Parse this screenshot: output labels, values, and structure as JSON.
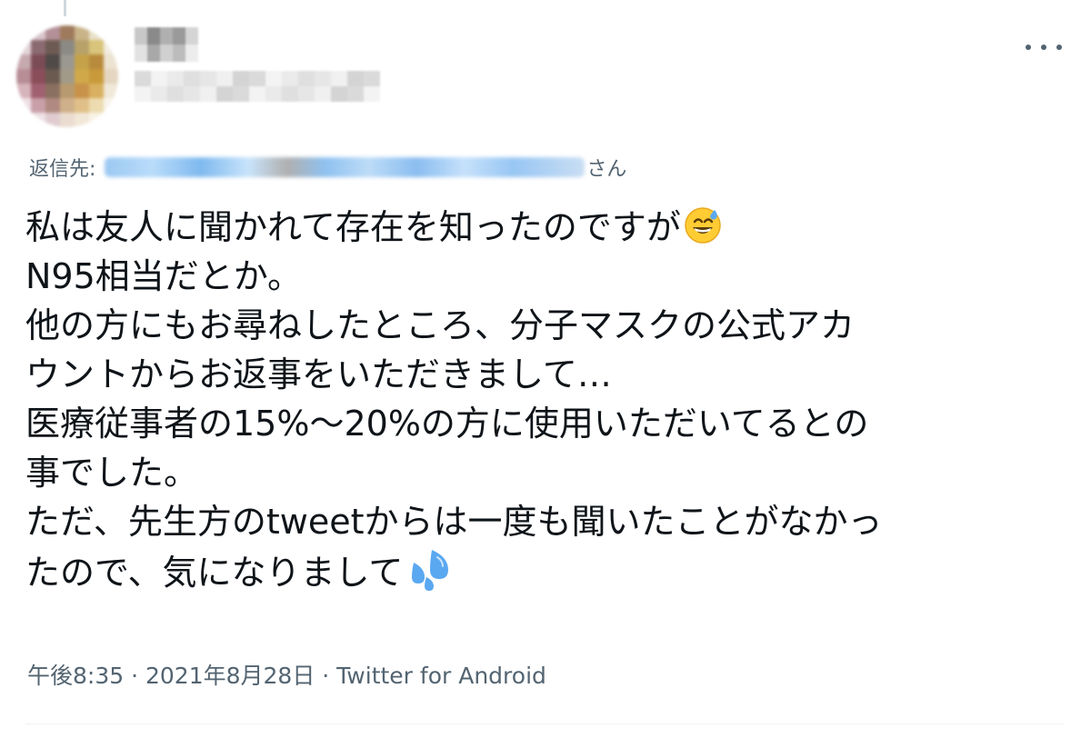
{
  "reply": {
    "prefix": "返信先: ",
    "suffix": "さん"
  },
  "tweet": {
    "lines": [
      "私は友人に聞かれて存在を知ったのですが",
      "N95相当だとか。",
      "他の方にもお尋ねしたところ、分子マスクの公式アカ",
      "ウントからお返事をいただきまして…",
      "医療従事者の15%〜20%の方に使用いただいてるとの",
      "事でした。",
      "ただ、先生方のtweetからは一度も聞いたことがなかっ",
      "たので、気になりまして"
    ],
    "emoji_1": "grinning-face-with-sweat",
    "emoji_2": "sweat-droplets"
  },
  "meta": {
    "time": "午後8:35",
    "separator": " · ",
    "date": "2021年8月28日",
    "source": "Twitter for Android"
  },
  "colors": {
    "secondary_text": "#536471",
    "primary_text": "#0f1419"
  }
}
